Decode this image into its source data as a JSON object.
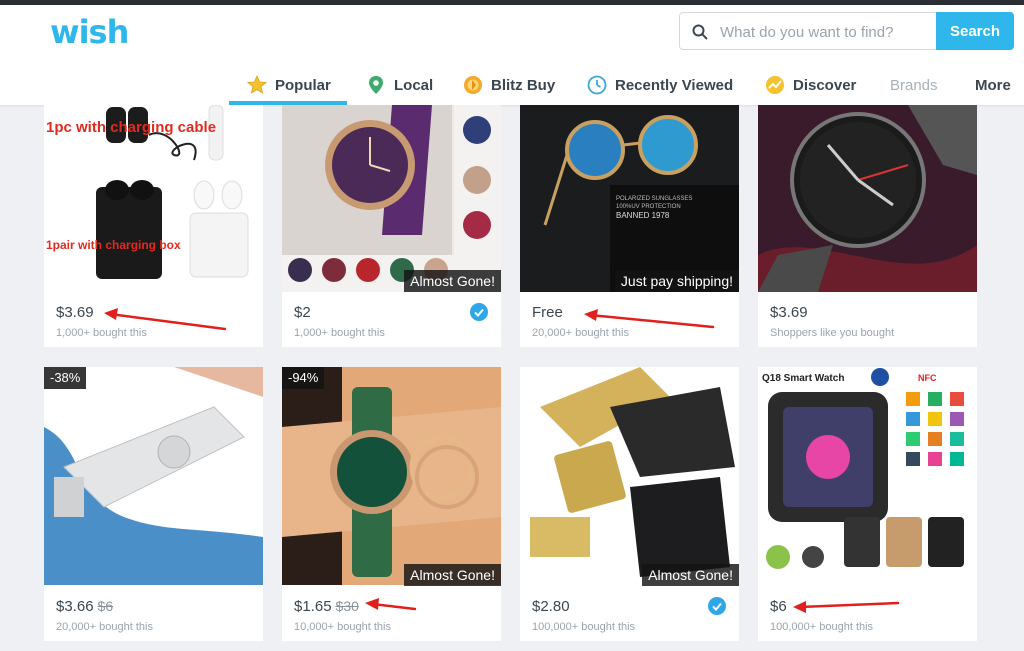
{
  "header": {
    "logo": "wish",
    "search": {
      "placeholder": "What do you want to find?",
      "button_label": "Search"
    }
  },
  "nav": {
    "tabs": [
      {
        "label": "Popular",
        "icon": "star-icon",
        "active": true
      },
      {
        "label": "Local",
        "icon": "location-pin-icon"
      },
      {
        "label": "Blitz Buy",
        "icon": "blitz-coin-icon"
      },
      {
        "label": "Recently Viewed",
        "icon": "clock-icon"
      },
      {
        "label": "Discover",
        "icon": "discover-icon"
      },
      {
        "label": "Brands"
      },
      {
        "label": "More"
      }
    ]
  },
  "products": [
    {
      "price": "$3.69",
      "bought": "1,000+ bought this",
      "image_text_1": "1pc with charging cable",
      "image_text_2": "1pair with charging box"
    },
    {
      "price": "$2",
      "bought": "1,000+ bought this",
      "badge": "Almost Gone!",
      "verified": true
    },
    {
      "price": "Free",
      "bought": "20,000+ bought this",
      "badge": "Just pay shipping!",
      "image_text_1": "POLARIZED SUNGLASSES",
      "image_text_2": "100%UV PROTECTION",
      "image_text_3": "BANNED 1978"
    },
    {
      "price": "$3.69",
      "bought": "Shoppers like you bought"
    },
    {
      "price": "$3.66",
      "old_price": "$6",
      "bought": "20,000+ bought this",
      "discount": "-38%"
    },
    {
      "price": "$1.65",
      "old_price": "$30",
      "bought": "10,000+ bought this",
      "discount": "-94%",
      "badge": "Almost Gone!"
    },
    {
      "price": "$2.80",
      "bought": "100,000+ bought this",
      "badge": "Almost Gone!",
      "verified": true
    },
    {
      "price": "$6",
      "bought": "100,000+ bought this",
      "image_text_1": "Q18 Smart Watch",
      "image_text_2": "NFC"
    }
  ],
  "colors": {
    "brand": "#2fb7ec",
    "annotation_arrow": "#e0201c",
    "text": "#3b4650"
  }
}
